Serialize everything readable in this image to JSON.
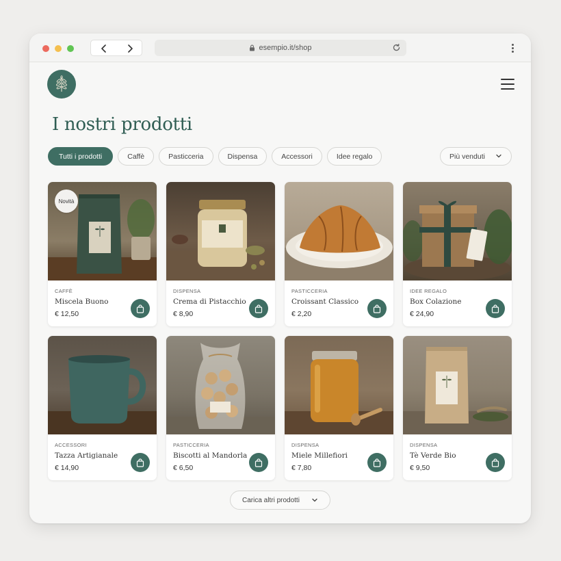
{
  "browser": {
    "url": "esempio.it/shop"
  },
  "page": {
    "title": "I nostri prodotti"
  },
  "filters": [
    {
      "label": "Tutti i prodotti",
      "active": true
    },
    {
      "label": "Caffè",
      "active": false
    },
    {
      "label": "Pasticceria",
      "active": false
    },
    {
      "label": "Dispensa",
      "active": false
    },
    {
      "label": "Accessori",
      "active": false
    },
    {
      "label": "Idee regalo",
      "active": false
    }
  ],
  "sort": {
    "selected": "Più venduti"
  },
  "products": [
    {
      "category": "CAFFÈ",
      "name": "Miscela Buono",
      "price": "€ 12,50",
      "badge": "Novità",
      "image": "coffee-bag"
    },
    {
      "category": "DISPENSA",
      "name": "Crema di Pistacchio",
      "price": "€ 8,90",
      "image": "pistachio-jar"
    },
    {
      "category": "PASTICCERIA",
      "name": "Croissant Classico",
      "price": "€ 2,20",
      "image": "croissant"
    },
    {
      "category": "IDEE REGALO",
      "name": "Box Colazione",
      "price": "€ 24,90",
      "image": "gift-box"
    },
    {
      "category": "ACCESSORI",
      "name": "Tazza Artigianale",
      "price": "€ 14,90",
      "image": "ceramic-mug"
    },
    {
      "category": "PASTICCERIA",
      "name": "Biscotti al Mandorla",
      "price": "€ 6,50",
      "image": "almond-biscuits"
    },
    {
      "category": "DISPENSA",
      "name": "Miele Millefiori",
      "price": "€ 7,80",
      "image": "honey-jar"
    },
    {
      "category": "DISPENSA",
      "name": "Tè Verde Bio",
      "price": "€ 9,50",
      "image": "tea-bag"
    }
  ],
  "load_more": {
    "label": "Carica altri prodotti"
  },
  "colors": {
    "brand": "#3f6e63",
    "title": "#2f5d53"
  }
}
